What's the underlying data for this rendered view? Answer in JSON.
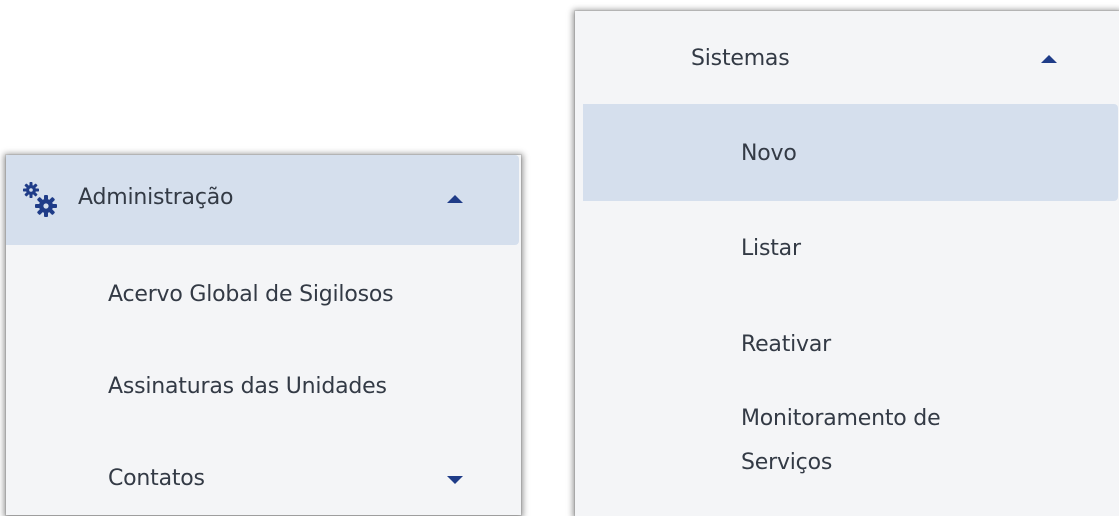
{
  "left_menu": {
    "header": {
      "icon": "cogs-icon",
      "label": "Administração",
      "expanded": true
    },
    "items": [
      {
        "label": "Acervo Global de Sigilosos"
      },
      {
        "label": "Assinaturas das Unidades"
      },
      {
        "label": "Contatos",
        "has_submenu": true,
        "expanded": false
      }
    ]
  },
  "right_menu": {
    "header": {
      "label": "Sistemas",
      "expanded": true
    },
    "items": [
      {
        "label": "Novo",
        "active": true
      },
      {
        "label": "Listar"
      },
      {
        "label": "Reativar"
      },
      {
        "label": "Monitoramento de Serviços"
      }
    ]
  },
  "colors": {
    "panel_bg": "#f4f5f7",
    "active_bg": "#d5dfed",
    "text": "#333a45",
    "accent": "#1f3c88"
  }
}
